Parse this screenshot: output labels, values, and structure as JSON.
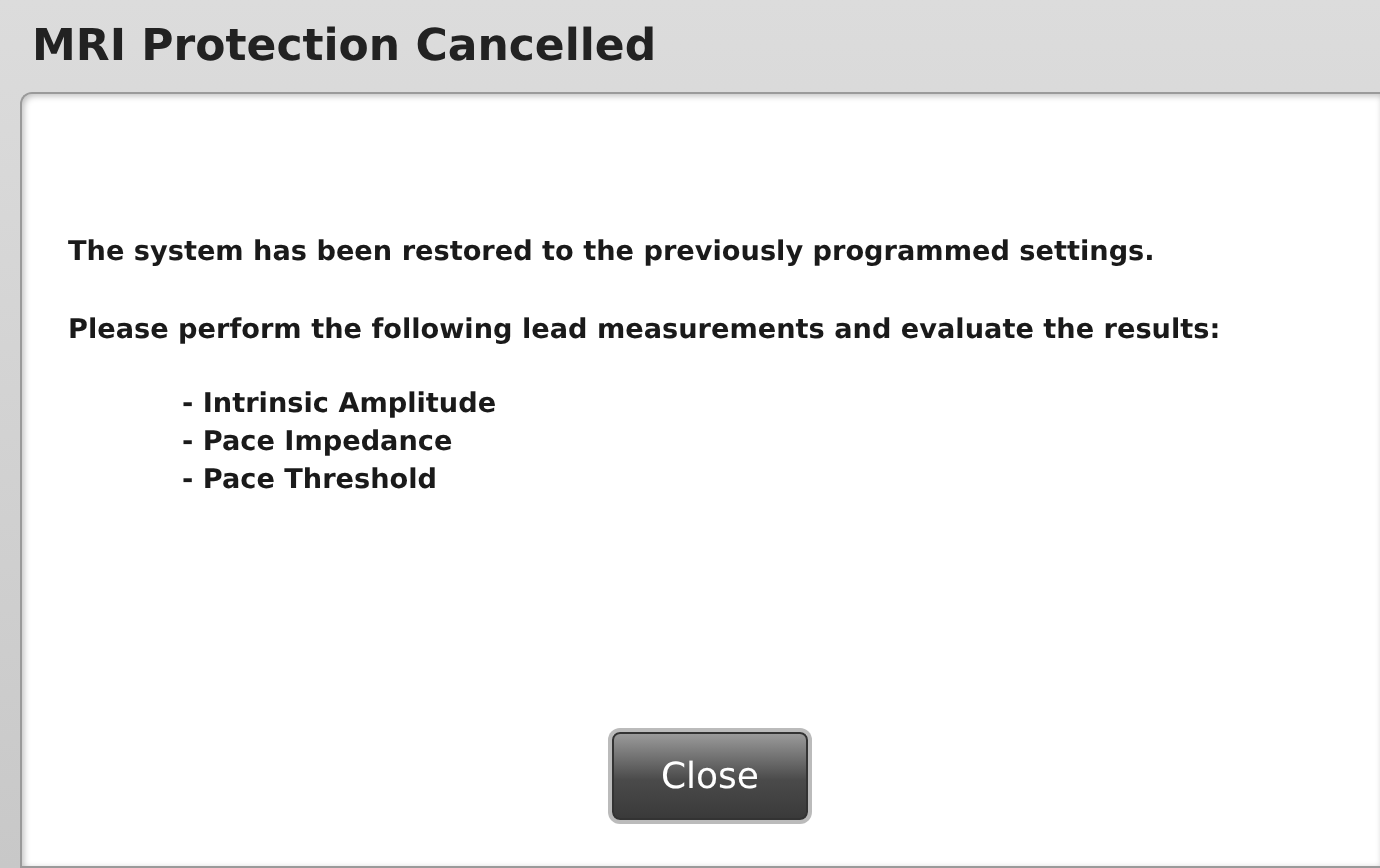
{
  "dialog": {
    "title": "MRI Protection Cancelled",
    "message": "The system has been restored to the previously programmed settings.",
    "instruction": "Please perform the following lead measurements and evaluate the results:",
    "measurements": [
      "- Intrinsic Amplitude",
      "- Pace Impedance",
      "- Pace Threshold"
    ],
    "buttons": [
      {
        "label": "Close"
      }
    ]
  }
}
